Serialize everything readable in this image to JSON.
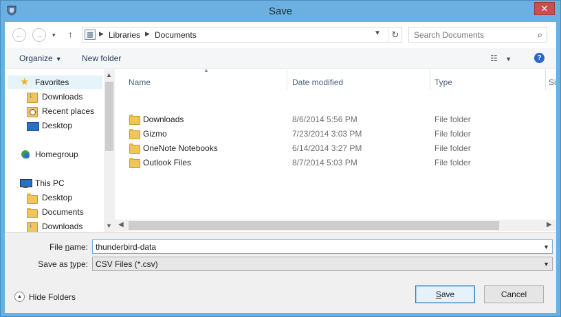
{
  "window": {
    "title": "Save",
    "close_glyph": "✕",
    "app_icon": "thunderbird-shield-icon"
  },
  "address_bar": {
    "crumbs": [
      "Libraries",
      "Documents"
    ],
    "search_placeholder": "Search Documents"
  },
  "toolbar": {
    "organize_label": "Organize",
    "new_folder_label": "New folder"
  },
  "nav": {
    "items": [
      {
        "label": "Favorites",
        "icon": "star-icon"
      },
      {
        "label": "Downloads",
        "icon": "downloads-icon"
      },
      {
        "label": "Recent places",
        "icon": "recent-places-icon"
      },
      {
        "label": "Desktop",
        "icon": "desktop-icon"
      },
      {
        "label": "Homegroup",
        "icon": "homegroup-icon"
      },
      {
        "label": "This PC",
        "icon": "computer-icon"
      },
      {
        "label": "Desktop",
        "icon": "folder-icon"
      },
      {
        "label": "Documents",
        "icon": "folder-icon"
      },
      {
        "label": "Downloads",
        "icon": "downloads-icon"
      }
    ]
  },
  "files": {
    "columns": [
      "Name",
      "Date modified",
      "Type",
      "Si"
    ],
    "rows": [
      {
        "name": "Downloads",
        "date": "8/6/2014 5:56 PM",
        "type": "File folder"
      },
      {
        "name": "Gizmo",
        "date": "7/23/2014 3:03 PM",
        "type": "File folder"
      },
      {
        "name": "OneNote Notebooks",
        "date": "6/14/2014 3:27 PM",
        "type": "File folder"
      },
      {
        "name": "Outlook Files",
        "date": "8/7/2014 5:03 PM",
        "type": "File folder"
      }
    ]
  },
  "form": {
    "file_name_label_pre": "File ",
    "file_name_label_acc": "n",
    "file_name_label_post": "ame:",
    "file_name_value": "thunderbird-data",
    "save_type_label_pre": "Save as ",
    "save_type_label_acc": "t",
    "save_type_label_post": "ype:",
    "save_type_value": "CSV Files (*.csv)",
    "hide_folders_label": "Hide Folders",
    "save_label_acc": "S",
    "save_label_post": "ave",
    "cancel_label": "Cancel"
  }
}
